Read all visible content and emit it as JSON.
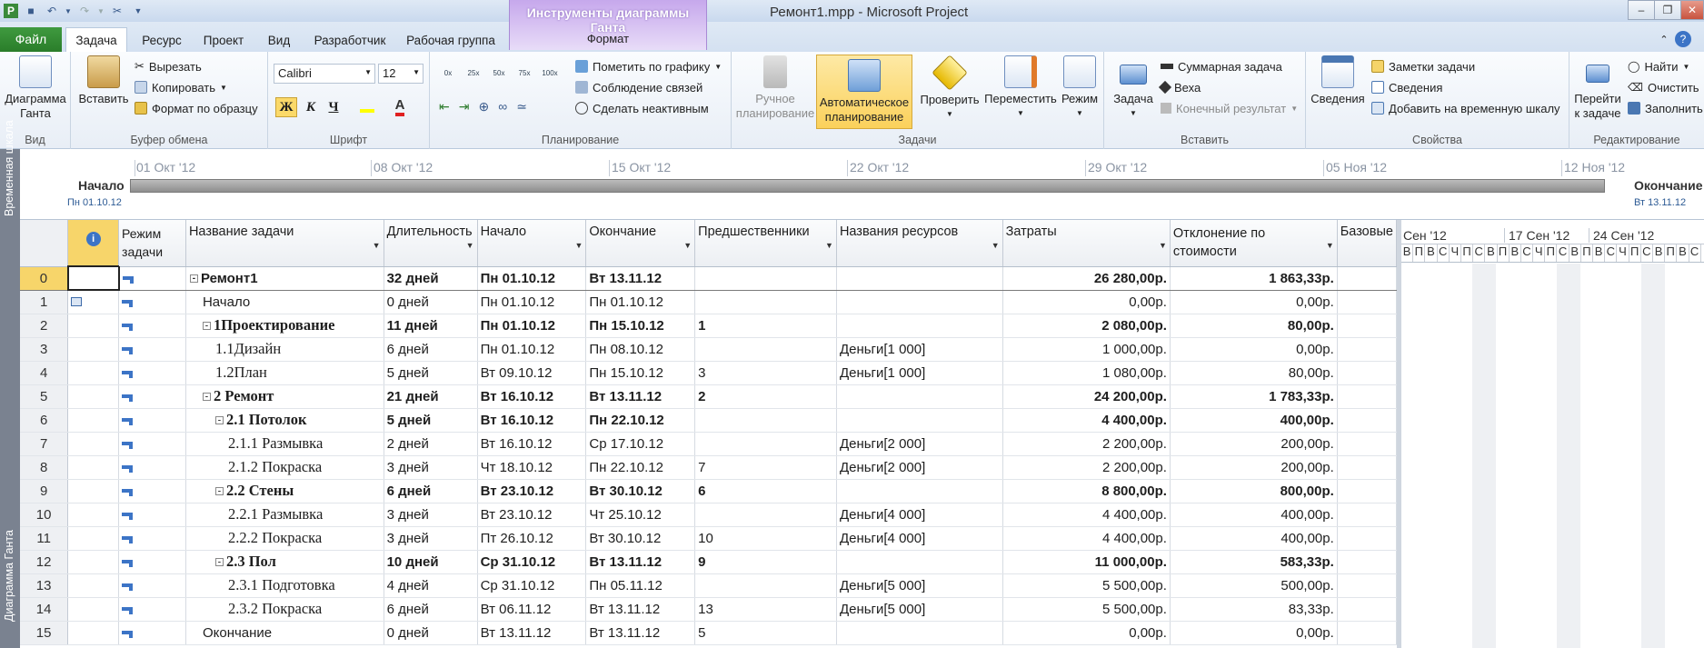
{
  "window": {
    "title": "Ремонт1.mpp - Microsoft Project",
    "contextual_group": "Инструменты диаграммы Ганта",
    "contextual_tab": "Формат"
  },
  "tabs": [
    "Файл",
    "Задача",
    "Ресурс",
    "Проект",
    "Вид",
    "Разработчик",
    "Рабочая группа"
  ],
  "ribbon": {
    "view": {
      "label": "Вид",
      "gantt_line1": "Диаграмма",
      "gantt_line2": "Ганта"
    },
    "clipboard": {
      "label": "Буфер обмена",
      "paste": "Вставить",
      "cut": "Вырезать",
      "copy": "Копировать",
      "format_painter": "Формат по образцу"
    },
    "font": {
      "label": "Шрифт",
      "name": "Calibri",
      "size": "12",
      "bold": "Ж",
      "italic": "К",
      "underline": "Ч"
    },
    "schedule": {
      "label": "Планирование",
      "mark": "Пометить по графику",
      "respect_links": "Соблюдение связей",
      "inactivate": "Сделать неактивным",
      "pct": [
        "0x",
        "25x",
        "50x",
        "75x",
        "100x"
      ]
    },
    "tasks": {
      "label": "Задачи",
      "manual_1": "Ручное",
      "manual_2": "планирование",
      "auto_1": "Автоматическое",
      "auto_2": "планирование",
      "inspect": "Проверить",
      "move": "Переместить",
      "mode": "Режим"
    },
    "insert": {
      "label": "Вставить",
      "task": "Задача",
      "summary": "Суммарная задача",
      "milestone": "Веха",
      "deliverable": "Конечный результат"
    },
    "properties": {
      "label": "Свойства",
      "info": "Сведения",
      "notes": "Заметки задачи",
      "details": "Сведения",
      "add_timeline": "Добавить на временную шкалу"
    },
    "editing": {
      "label": "Редактирование",
      "goto_1": "Перейти",
      "goto_2": "к задаче",
      "find": "Найти",
      "clear": "Очистить",
      "fill": "Заполнить"
    }
  },
  "timeline": {
    "side_label": "Временная шкала",
    "start_label": "Начало",
    "start_date": "Пн 01.10.12",
    "end_label": "Окончание",
    "end_date": "Вт 13.11.12",
    "dates": [
      "01 Окт '12",
      "08 Окт '12",
      "15 Окт '12",
      "22 Окт '12",
      "29 Окт '12",
      "05 Ноя '12",
      "12 Ноя '12"
    ]
  },
  "view_label": "Диаграмма Ганта",
  "columns": [
    "Режим задачи",
    "Название задачи",
    "Длительность",
    "Начало",
    "Окончание",
    "Предшественники",
    "Названия ресурсов",
    "Затраты",
    "Отклонение по стоимости",
    "Базовые"
  ],
  "rows": [
    {
      "id": "0",
      "name": "Ремонт1",
      "dur": "32 дней",
      "start": "Пн 01.10.12",
      "finish": "Вт 13.11.12",
      "pred": "",
      "res": "",
      "cost": "26 280,00р.",
      "var": "1 863,33р.",
      "level": 0,
      "summary": true
    },
    {
      "id": "1",
      "name": "Начало",
      "dur": "0 дней",
      "start": "Пн 01.10.12",
      "finish": "Пн 01.10.12",
      "pred": "",
      "res": "",
      "cost": "0,00р.",
      "var": "0,00р.",
      "level": 1,
      "summary": false
    },
    {
      "id": "2",
      "name": "1Проектирование",
      "dur": "11 дней",
      "start": "Пн 01.10.12",
      "finish": "Пн 15.10.12",
      "pred": "1",
      "res": "",
      "cost": "2 080,00р.",
      "var": "80,00р.",
      "level": 1,
      "summary": true
    },
    {
      "id": "3",
      "name": "1.1Дизайн",
      "dur": "6 дней",
      "start": "Пн 01.10.12",
      "finish": "Пн 08.10.12",
      "pred": "",
      "res": "Деньги[1 000]",
      "cost": "1 000,00р.",
      "var": "0,00р.",
      "level": 2,
      "summary": false
    },
    {
      "id": "4",
      "name": "1.2План",
      "dur": "5 дней",
      "start": "Вт 09.10.12",
      "finish": "Пн 15.10.12",
      "pred": "3",
      "res": "Деньги[1 000]",
      "cost": "1 080,00р.",
      "var": "80,00р.",
      "level": 2,
      "summary": false
    },
    {
      "id": "5",
      "name": "2 Ремонт",
      "dur": "21 дней",
      "start": "Вт 16.10.12",
      "finish": "Вт 13.11.12",
      "pred": "2",
      "res": "",
      "cost": "24 200,00р.",
      "var": "1 783,33р.",
      "level": 1,
      "summary": true
    },
    {
      "id": "6",
      "name": "2.1 Потолок",
      "dur": "5 дней",
      "start": "Вт 16.10.12",
      "finish": "Пн 22.10.12",
      "pred": "",
      "res": "",
      "cost": "4 400,00р.",
      "var": "400,00р.",
      "level": 2,
      "summary": true
    },
    {
      "id": "7",
      "name": "2.1.1 Размывка",
      "dur": "2 дней",
      "start": "Вт 16.10.12",
      "finish": "Ср 17.10.12",
      "pred": "",
      "res": "Деньги[2 000]",
      "cost": "2 200,00р.",
      "var": "200,00р.",
      "level": 3,
      "summary": false
    },
    {
      "id": "8",
      "name": "2.1.2 Покраска",
      "dur": "3 дней",
      "start": "Чт 18.10.12",
      "finish": "Пн 22.10.12",
      "pred": "7",
      "res": "Деньги[2 000]",
      "cost": "2 200,00р.",
      "var": "200,00р.",
      "level": 3,
      "summary": false
    },
    {
      "id": "9",
      "name": "2.2 Стены",
      "dur": "6 дней",
      "start": "Вт 23.10.12",
      "finish": "Вт 30.10.12",
      "pred": "6",
      "res": "",
      "cost": "8 800,00р.",
      "var": "800,00р.",
      "level": 2,
      "summary": true
    },
    {
      "id": "10",
      "name": "2.2.1 Размывка",
      "dur": "3 дней",
      "start": "Вт 23.10.12",
      "finish": "Чт 25.10.12",
      "pred": "",
      "res": "Деньги[4 000]",
      "cost": "4 400,00р.",
      "var": "400,00р.",
      "level": 3,
      "summary": false
    },
    {
      "id": "11",
      "name": "2.2.2 Покраска",
      "dur": "3 дней",
      "start": "Пт 26.10.12",
      "finish": "Вт 30.10.12",
      "pred": "10",
      "res": "Деньги[4 000]",
      "cost": "4 400,00р.",
      "var": "400,00р.",
      "level": 3,
      "summary": false
    },
    {
      "id": "12",
      "name": "2.3 Пол",
      "dur": "10 дней",
      "start": "Ср 31.10.12",
      "finish": "Вт 13.11.12",
      "pred": "9",
      "res": "",
      "cost": "11 000,00р.",
      "var": "583,33р.",
      "level": 2,
      "summary": true
    },
    {
      "id": "13",
      "name": "2.3.1 Подготовка",
      "dur": "4 дней",
      "start": "Ср 31.10.12",
      "finish": "Пн 05.11.12",
      "pred": "",
      "res": "Деньги[5 000]",
      "cost": "5 500,00р.",
      "var": "500,00р.",
      "level": 3,
      "summary": false
    },
    {
      "id": "14",
      "name": "2.3.2 Покраска",
      "dur": "6 дней",
      "start": "Вт 06.11.12",
      "finish": "Вт 13.11.12",
      "pred": "13",
      "res": "Деньги[5 000]",
      "cost": "5 500,00р.",
      "var": "83,33р.",
      "level": 3,
      "summary": false
    },
    {
      "id": "15",
      "name": "Окончание",
      "dur": "0 дней",
      "start": "Вт 13.11.12",
      "finish": "Вт 13.11.12",
      "pred": "5",
      "res": "",
      "cost": "0,00р.",
      "var": "0,00р.",
      "level": 1,
      "summary": false
    }
  ],
  "gantt": {
    "weeks": [
      "Сен '12",
      "17 Сен '12",
      "24 Сен '12"
    ],
    "days": [
      "В",
      "П",
      "В",
      "С",
      "Ч",
      "П",
      "С",
      "В",
      "П",
      "В",
      "С",
      "Ч",
      "П",
      "С",
      "В",
      "П",
      "В",
      "С",
      "Ч",
      "П",
      "С",
      "В",
      "П",
      "В",
      "С"
    ]
  },
  "colors": {
    "file_tab": "#2a7d2a",
    "selected_row": "#f7d56a",
    "highlight_button": "#fbd969",
    "contextual": "#c6a8ec"
  }
}
